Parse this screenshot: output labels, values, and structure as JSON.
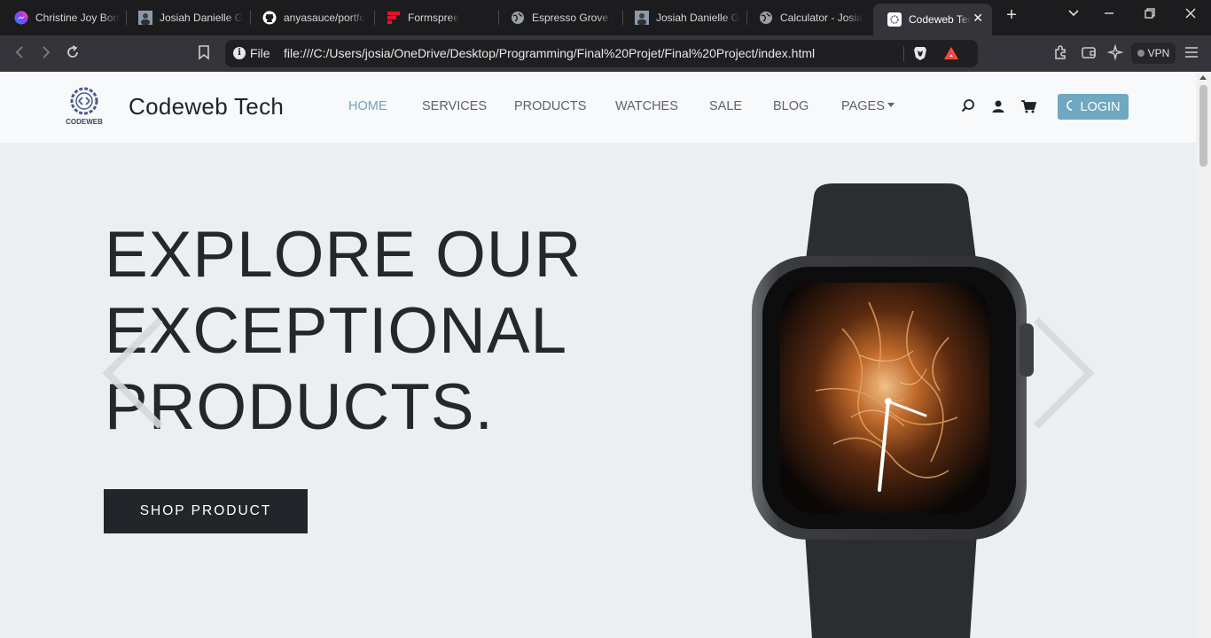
{
  "browser": {
    "tabs": [
      {
        "title": "Christine Joy Borr",
        "icon": "messenger-icon"
      },
      {
        "title": "Josiah Danielle G",
        "icon": "avatar-icon"
      },
      {
        "title": "anyasauce/portfo",
        "icon": "github-icon"
      },
      {
        "title": "Formspree",
        "icon": "formspree-icon"
      },
      {
        "title": "Espresso Grove |",
        "icon": "globe-icon"
      },
      {
        "title": "Josiah Danielle G",
        "icon": "avatar-icon"
      },
      {
        "title": "Calculator - Josia",
        "icon": "globe-icon"
      },
      {
        "title": "Codeweb Tec",
        "icon": "codeweb-icon",
        "active": true
      }
    ],
    "new_tab_symbol": "+",
    "address": {
      "scheme_label": "File",
      "url": "file:///C:/Users/josia/OneDrive/Desktop/Programming/Final%20Projet/Final%20Project/index.html"
    },
    "vpn_label": "VPN",
    "accent_colors": {
      "brave": "#fb542b",
      "bat": "#ff1893"
    }
  },
  "site": {
    "logo_text": "CODEWEB",
    "brand": "Codeweb Tech",
    "nav": [
      {
        "label": "HOME",
        "active": true
      },
      {
        "label": "SERVICES"
      },
      {
        "label": "PRODUCTS"
      },
      {
        "label": "WATCHES"
      },
      {
        "label": "SALE"
      },
      {
        "label": "BLOG"
      },
      {
        "label": "PAGES",
        "dropdown": true
      }
    ],
    "icons": [
      "search-icon",
      "user-icon",
      "cart-icon"
    ],
    "login_label": "LOGIN",
    "accent": "#6fa8c0"
  },
  "hero": {
    "title_lines": [
      "EXPLORE OUR",
      "EXCEPTIONAL",
      "PRODUCTS."
    ],
    "cta_label": "SHOP PRODUCT",
    "image": "smartwatch-product-image"
  }
}
